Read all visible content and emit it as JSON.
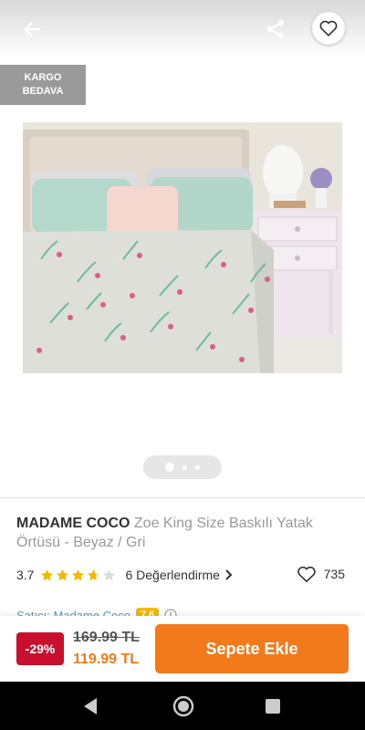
{
  "header": {
    "back_icon": "arrow-left-icon",
    "share_icon": "share-icon",
    "favorite_icon": "heart-icon"
  },
  "badge": {
    "line1": "KARGO",
    "line2": "BEDAVA"
  },
  "gallery": {
    "image_description_icon": "bed-product-photo",
    "page_count": 3,
    "active_page": 1
  },
  "product": {
    "brand": "MADAME COCO",
    "name": "Zoe King Size Baskılı Yatak Örtüsü - Beyaz / Gri",
    "rating": "3.7",
    "rating_value": 3.7,
    "reviews_label": "6 Değerlendirme",
    "favorite_count": "735"
  },
  "seller": {
    "label": "Satıcı: Madame Coco",
    "score": "7.6"
  },
  "pricing": {
    "discount": "-29%",
    "old_price": "169.99 TL",
    "new_price": "119.99 TL",
    "cart_label": "Sepete Ekle"
  },
  "colors": {
    "accent": "#f27a1a",
    "discount": "#c8102e",
    "star": "#f5b800"
  }
}
